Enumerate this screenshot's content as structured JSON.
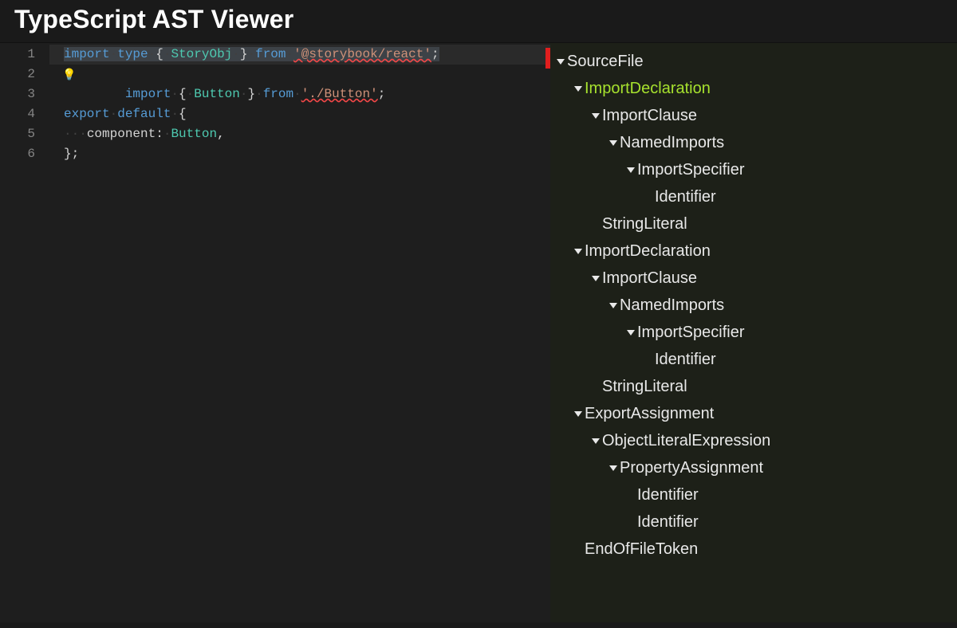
{
  "header": {
    "title": "TypeScript AST Viewer"
  },
  "editor": {
    "line_numbers": [
      "1",
      "2",
      "3",
      "4",
      "5",
      "6"
    ],
    "line1": {
      "import": "import",
      "ws": "·",
      "type": "type",
      "lb": "{",
      "ident": "StoryObj",
      "rb": "}",
      "from": "from",
      "str": "'@storybook/react'",
      "semi": ";"
    },
    "line2": {
      "import": "import",
      "ws": "·",
      "lb": "{",
      "ident": "Button",
      "rb": "}",
      "from": "from",
      "str": "'./Button'",
      "semi": ";"
    },
    "line4": {
      "export": "export",
      "ws": "·",
      "default": "default",
      "lb": "{"
    },
    "line5": {
      "indent": "···",
      "key": "component",
      "colon": ":",
      "ws": "·",
      "val": "Button",
      "comma": ","
    },
    "line6": {
      "rb": "}",
      "semi": ";"
    }
  },
  "tree": [
    {
      "label": "SourceFile",
      "depth": 0,
      "caret": true
    },
    {
      "label": "ImportDeclaration",
      "depth": 1,
      "caret": true,
      "selected": true
    },
    {
      "label": "ImportClause",
      "depth": 2,
      "caret": true
    },
    {
      "label": "NamedImports",
      "depth": 3,
      "caret": true
    },
    {
      "label": "ImportSpecifier",
      "depth": 4,
      "caret": true
    },
    {
      "label": "Identifier",
      "depth": 5,
      "caret": false
    },
    {
      "label": "StringLiteral",
      "depth": 2,
      "caret": false
    },
    {
      "label": "ImportDeclaration",
      "depth": 1,
      "caret": true
    },
    {
      "label": "ImportClause",
      "depth": 2,
      "caret": true
    },
    {
      "label": "NamedImports",
      "depth": 3,
      "caret": true
    },
    {
      "label": "ImportSpecifier",
      "depth": 4,
      "caret": true
    },
    {
      "label": "Identifier",
      "depth": 5,
      "caret": false
    },
    {
      "label": "StringLiteral",
      "depth": 2,
      "caret": false
    },
    {
      "label": "ExportAssignment",
      "depth": 1,
      "caret": true
    },
    {
      "label": "ObjectLiteralExpression",
      "depth": 2,
      "caret": true
    },
    {
      "label": "PropertyAssignment",
      "depth": 3,
      "caret": true
    },
    {
      "label": "Identifier",
      "depth": 4,
      "caret": false
    },
    {
      "label": "Identifier",
      "depth": 4,
      "caret": false
    },
    {
      "label": "EndOfFileToken",
      "depth": 1,
      "caret": false
    }
  ]
}
